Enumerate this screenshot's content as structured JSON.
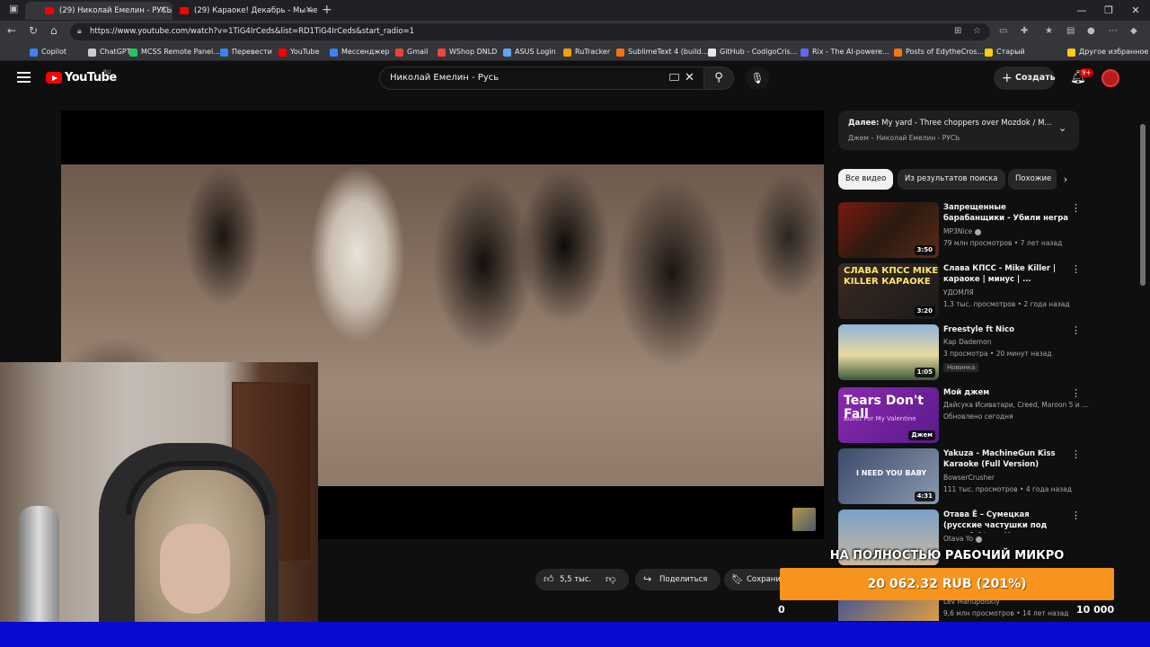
{
  "browser": {
    "tabs": [
      {
        "title": "(29) Николай Емелин - РУСЬ"
      },
      {
        "title": "(29) Караоке! Декабрь - Мы не"
      }
    ],
    "url": "https://www.youtube.com/watch?v=1TiG4IrCeds&list=RD1TiG4IrCeds&start_radio=1",
    "bookmarks": [
      {
        "label": "Copilot",
        "color": "#3b82f6"
      },
      {
        "label": "ChatGPT",
        "color": "#cccccc"
      },
      {
        "label": "MCSS Remote Panel...",
        "color": "#22c55e"
      },
      {
        "label": "Перевести",
        "color": "#3b82f6"
      },
      {
        "label": "YouTube",
        "color": "#ff0000"
      },
      {
        "label": "Мессенджер",
        "color": "#3b82f6"
      },
      {
        "label": "Gmail",
        "color": "#ea4335"
      },
      {
        "label": "WShop DNLD",
        "color": "#ef4444"
      },
      {
        "label": "ASUS Login",
        "color": "#60a5fa"
      },
      {
        "label": "RuTracker",
        "color": "#f59e0b"
      },
      {
        "label": "SublimeText 4 (build...",
        "color": "#f97316"
      },
      {
        "label": "GitHub - CodigoCris...",
        "color": "#e5e7eb"
      },
      {
        "label": "Rix - The AI-powere...",
        "color": "#6366f1"
      },
      {
        "label": "Posts of EdytheCros...",
        "color": "#f97316"
      },
      {
        "label": "Старый",
        "color": "#facc15"
      },
      {
        "label": "Другое избранное",
        "color": "#facc15"
      }
    ]
  },
  "youtube": {
    "logo": "YouTube",
    "region": "RU",
    "search_value": "Николай Емелин - Русь",
    "create_label": "Создать",
    "notif_count": "9+"
  },
  "video": {
    "likes": "5,5 тыс.",
    "share_label": "Поделиться",
    "save_label": "Сохранить"
  },
  "upnext": {
    "prefix": "Далее:",
    "title": "My yard - Three choppers over Mozdok / M...",
    "subtitle": "Джем – Николай Емелин - РУСЬ"
  },
  "chips": [
    "Все видео",
    "Из результатов поиска",
    "Похожие"
  ],
  "recommendations": [
    {
      "title": "Запрещенные барабанщики - Убили негра",
      "channel": "MP3Nice",
      "verified": true,
      "meta": "79 млн просмотров • 7 лет назад",
      "duration": "3:50",
      "thumb_text": "",
      "badge": ""
    },
    {
      "title": "Слава КПСС - Mike Killer | караоке | минус | ...",
      "channel": "УДОМЛЯ",
      "verified": false,
      "meta": "1,3 тыс. просмотров • 2 года назад",
      "duration": "3:20",
      "thumb_text": "СЛАВА КПСС MIKE KILLER КАРАОКЕ",
      "badge": ""
    },
    {
      "title": "Freestyle ft Nico",
      "channel": "Кар Dademon",
      "verified": false,
      "meta": "3 просмотра • 20 минут назад",
      "duration": "1:05",
      "thumb_text": "",
      "badge": "Новинка"
    },
    {
      "title": "Мой джем",
      "channel": "Дайсука Исиватари, Creed, Maroon 5 и ...",
      "verified": false,
      "meta": "Обновлено сегодня",
      "duration": "Джем",
      "thumb_text": "Tears Don't Fall",
      "thumb_sub": "Bullet For My Valentine",
      "badge": ""
    },
    {
      "title": "Yakuza - MachineGun Kiss Karaoke (Full Version)",
      "channel": "BowserCrusher",
      "verified": false,
      "meta": "111 тыс. просмотров • 4 года назад",
      "duration": "4:31",
      "thumb_text": "I NEED YOU BABY",
      "badge": ""
    },
    {
      "title": "Отава Ё – Сумецкая (русские частушки под драку) Otava Y...",
      "channel": "Otava Yo",
      "verified": true,
      "meta": "",
      "duration": "",
      "thumb_text": "",
      "badge": ""
    },
    {
      "title": "",
      "channel": "Lev Mariupolskiy",
      "verified": false,
      "meta": "9,6 млн просмотров • 14 лет назад",
      "duration": "",
      "thumb_text": "",
      "badge": ""
    }
  ],
  "overlay": {
    "caption": "НА ПОЛНОСТЬЮ РАБОЧИЙ МИКРО",
    "goal_text": "20 062.32 RUB (201%)",
    "goal_progress_percent": 201,
    "min_label": "0",
    "max_label": "10 000"
  }
}
